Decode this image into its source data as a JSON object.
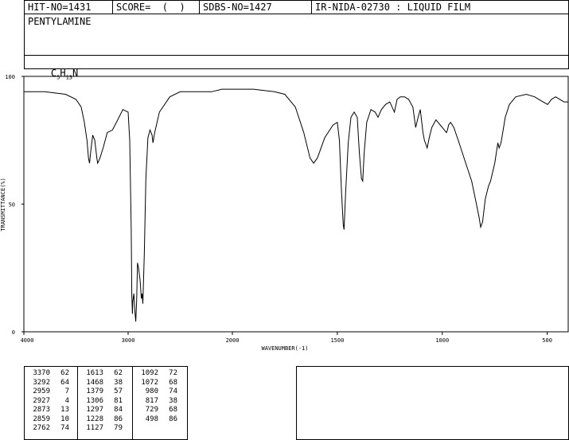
{
  "header": {
    "hit_no": "HIT-NO=1431",
    "score": "SCORE=  (  )",
    "sdbs_no": "SDBS-NO=1427",
    "ir_code": "IR-NIDA-02730 : LIQUID FILM"
  },
  "compound": {
    "name": "PENTYLAMINE",
    "formula_parts": [
      "C",
      "5",
      "H",
      "13",
      "N"
    ]
  },
  "chart_data": {
    "type": "line",
    "xlabel": "WAVENUMBER(-1)",
    "ylabel": "TRANSMITTANCE(%)",
    "xlim": [
      4000,
      400
    ],
    "ylim": [
      0,
      100
    ],
    "x_ticks": [
      "4000",
      "3000",
      "2000",
      "1500",
      "1000",
      "500"
    ],
    "x_tick_values": [
      4000,
      3000,
      2000,
      1500,
      1000,
      500
    ],
    "y_ticks": [
      "0",
      "50",
      "100"
    ],
    "y_tick_values": [
      0,
      50,
      100
    ],
    "series": [
      {
        "points": [
          [
            4000,
            94
          ],
          [
            3800,
            94
          ],
          [
            3600,
            93
          ],
          [
            3500,
            91
          ],
          [
            3450,
            88
          ],
          [
            3420,
            82
          ],
          [
            3395,
            75
          ],
          [
            3380,
            68
          ],
          [
            3370,
            66
          ],
          [
            3355,
            72
          ],
          [
            3340,
            77
          ],
          [
            3320,
            75
          ],
          [
            3300,
            68
          ],
          [
            3292,
            66
          ],
          [
            3270,
            68
          ],
          [
            3240,
            72
          ],
          [
            3200,
            78
          ],
          [
            3150,
            79
          ],
          [
            3100,
            83
          ],
          [
            3050,
            87
          ],
          [
            3000,
            86
          ],
          [
            2985,
            75
          ],
          [
            2970,
            40
          ],
          [
            2965,
            15
          ],
          [
            2959,
            7
          ],
          [
            2955,
            12
          ],
          [
            2945,
            15
          ],
          [
            2935,
            8
          ],
          [
            2927,
            4
          ],
          [
            2918,
            12
          ],
          [
            2910,
            27
          ],
          [
            2900,
            25
          ],
          [
            2885,
            20
          ],
          [
            2873,
            13
          ],
          [
            2866,
            15
          ],
          [
            2859,
            11
          ],
          [
            2845,
            30
          ],
          [
            2830,
            60
          ],
          [
            2810,
            76
          ],
          [
            2790,
            79
          ],
          [
            2770,
            77
          ],
          [
            2762,
            74
          ],
          [
            2745,
            78
          ],
          [
            2700,
            86
          ],
          [
            2600,
            92
          ],
          [
            2500,
            94
          ],
          [
            2400,
            94
          ],
          [
            2300,
            94
          ],
          [
            2200,
            94
          ],
          [
            2100,
            95
          ],
          [
            2000,
            95
          ],
          [
            1900,
            95
          ],
          [
            1800,
            94
          ],
          [
            1750,
            93
          ],
          [
            1700,
            88
          ],
          [
            1660,
            78
          ],
          [
            1630,
            68
          ],
          [
            1613,
            66
          ],
          [
            1595,
            68
          ],
          [
            1560,
            76
          ],
          [
            1520,
            81
          ],
          [
            1500,
            82
          ],
          [
            1490,
            75
          ],
          [
            1480,
            55
          ],
          [
            1472,
            42
          ],
          [
            1468,
            40
          ],
          [
            1460,
            55
          ],
          [
            1448,
            74
          ],
          [
            1435,
            84
          ],
          [
            1420,
            86
          ],
          [
            1405,
            84
          ],
          [
            1395,
            70
          ],
          [
            1385,
            60
          ],
          [
            1379,
            59
          ],
          [
            1372,
            70
          ],
          [
            1360,
            82
          ],
          [
            1340,
            87
          ],
          [
            1320,
            86
          ],
          [
            1306,
            84
          ],
          [
            1290,
            87
          ],
          [
            1270,
            89
          ],
          [
            1250,
            90
          ],
          [
            1228,
            86
          ],
          [
            1215,
            91
          ],
          [
            1200,
            92
          ],
          [
            1180,
            92
          ],
          [
            1160,
            91
          ],
          [
            1140,
            88
          ],
          [
            1127,
            80
          ],
          [
            1115,
            84
          ],
          [
            1105,
            87
          ],
          [
            1092,
            78
          ],
          [
            1085,
            75
          ],
          [
            1072,
            72
          ],
          [
            1062,
            76
          ],
          [
            1050,
            80
          ],
          [
            1030,
            83
          ],
          [
            1010,
            81
          ],
          [
            990,
            79
          ],
          [
            980,
            78
          ],
          [
            975,
            79
          ],
          [
            970,
            81
          ],
          [
            960,
            82
          ],
          [
            945,
            80
          ],
          [
            920,
            74
          ],
          [
            900,
            69
          ],
          [
            880,
            64
          ],
          [
            860,
            59
          ],
          [
            840,
            51
          ],
          [
            825,
            45
          ],
          [
            817,
            41
          ],
          [
            808,
            43
          ],
          [
            795,
            52
          ],
          [
            780,
            57
          ],
          [
            770,
            59
          ],
          [
            750,
            66
          ],
          [
            735,
            74
          ],
          [
            729,
            72
          ],
          [
            720,
            74
          ],
          [
            700,
            84
          ],
          [
            680,
            89
          ],
          [
            650,
            92
          ],
          [
            600,
            93
          ],
          [
            560,
            92
          ],
          [
            520,
            90
          ],
          [
            498,
            89
          ],
          [
            480,
            91
          ],
          [
            460,
            92
          ],
          [
            440,
            91
          ],
          [
            420,
            90
          ],
          [
            400,
            90
          ]
        ]
      }
    ]
  },
  "peak_table": {
    "col1": [
      [
        "3370",
        "62"
      ],
      [
        "3292",
        "64"
      ],
      [
        "2959",
        "7"
      ],
      [
        "2927",
        "4"
      ],
      [
        "2873",
        "13"
      ],
      [
        "2859",
        "10"
      ],
      [
        "2762",
        "74"
      ]
    ],
    "col2": [
      [
        "1613",
        "62"
      ],
      [
        "1468",
        "38"
      ],
      [
        "1379",
        "57"
      ],
      [
        "1306",
        "81"
      ],
      [
        "1297",
        "84"
      ],
      [
        "1228",
        "86"
      ],
      [
        "1127",
        "79"
      ]
    ],
    "col3": [
      [
        "1092",
        "72"
      ],
      [
        "1072",
        "68"
      ],
      [
        "980",
        "74"
      ],
      [
        "817",
        "38"
      ],
      [
        "729",
        "68"
      ],
      [
        "498",
        "86"
      ]
    ]
  }
}
